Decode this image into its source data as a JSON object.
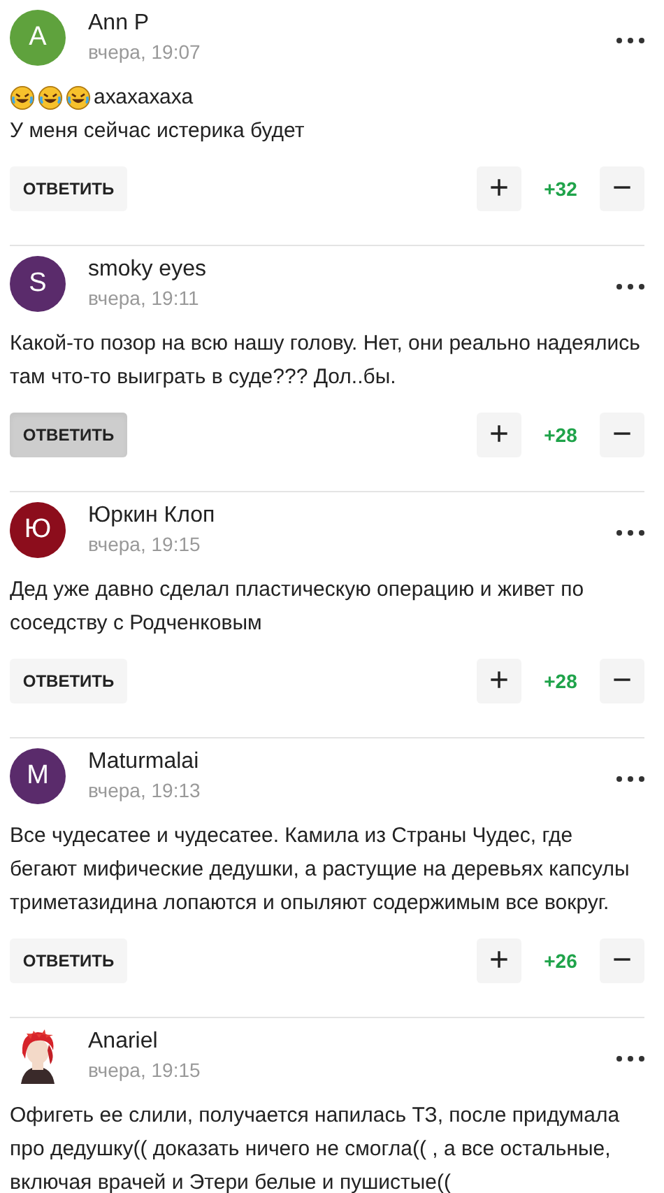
{
  "comments": [
    {
      "author": "Ann P",
      "avatar": {
        "kind": "letter",
        "letter": "A",
        "color": "#5fa23d"
      },
      "time": "вчера, 19:07",
      "lines": [
        {
          "icons": [
            {
              "kind": "laugh"
            },
            {
              "kind": "laugh"
            },
            {
              "kind": "laugh"
            }
          ],
          "text": "ахахахаха"
        },
        {
          "text": "У меня сейчас истерика будет"
        }
      ],
      "reply": {
        "label": "ОТВЕТИТЬ",
        "pressed": false
      },
      "plus": "+",
      "score": "+32",
      "minus": "−"
    },
    {
      "author": "smoky eyes",
      "avatar": {
        "kind": "letter",
        "letter": "S",
        "color": "#5a2b6b"
      },
      "time": "вчера, 19:11",
      "lines": [
        {
          "text": "Какой-то позор на всю нашу голову. Нет, они реально надеялись там что-то выиграть в суде??? Дол..бы."
        }
      ],
      "reply": {
        "label": "ОТВЕТИТЬ",
        "pressed": true
      },
      "plus": "+",
      "score": "+28",
      "minus": "−"
    },
    {
      "author": "Юркин Клоп",
      "avatar": {
        "kind": "letter",
        "letter": "Ю",
        "color": "#8c0d1c"
      },
      "time": "вчера, 19:15",
      "lines": [
        {
          "text": "Дед уже давно сделал пластическую операцию и живет по соседству с Родченковым"
        }
      ],
      "reply": {
        "label": "ОТВЕТИТЬ",
        "pressed": false
      },
      "plus": "+",
      "score": "+28",
      "minus": "−"
    },
    {
      "author": "Maturmalai",
      "avatar": {
        "kind": "letter",
        "letter": "M",
        "color": "#5a2b6b"
      },
      "time": "вчера, 19:13",
      "lines": [
        {
          "text": "Все чудесатее и чудесатее. Камила из Страны Чудес, где бегают мифические дедушки, а растущие на деревьях капсулы триметазидина лопаются и опыляют содержимым все вокруг."
        }
      ],
      "reply": {
        "label": "ОТВЕТИТЬ",
        "pressed": false
      },
      "plus": "+",
      "score": "+26",
      "minus": "−"
    },
    {
      "author": "Anariel",
      "avatar": {
        "kind": "picture"
      },
      "time": "вчера, 19:15",
      "lines": [
        {
          "text": "Офигеть ее слили, получается напилась ТЗ, после придумала про дедушку(( доказать ничего не смогла(( , а все остальные, включая врачей и Этери белые и пушистые(("
        }
      ]
    }
  ]
}
